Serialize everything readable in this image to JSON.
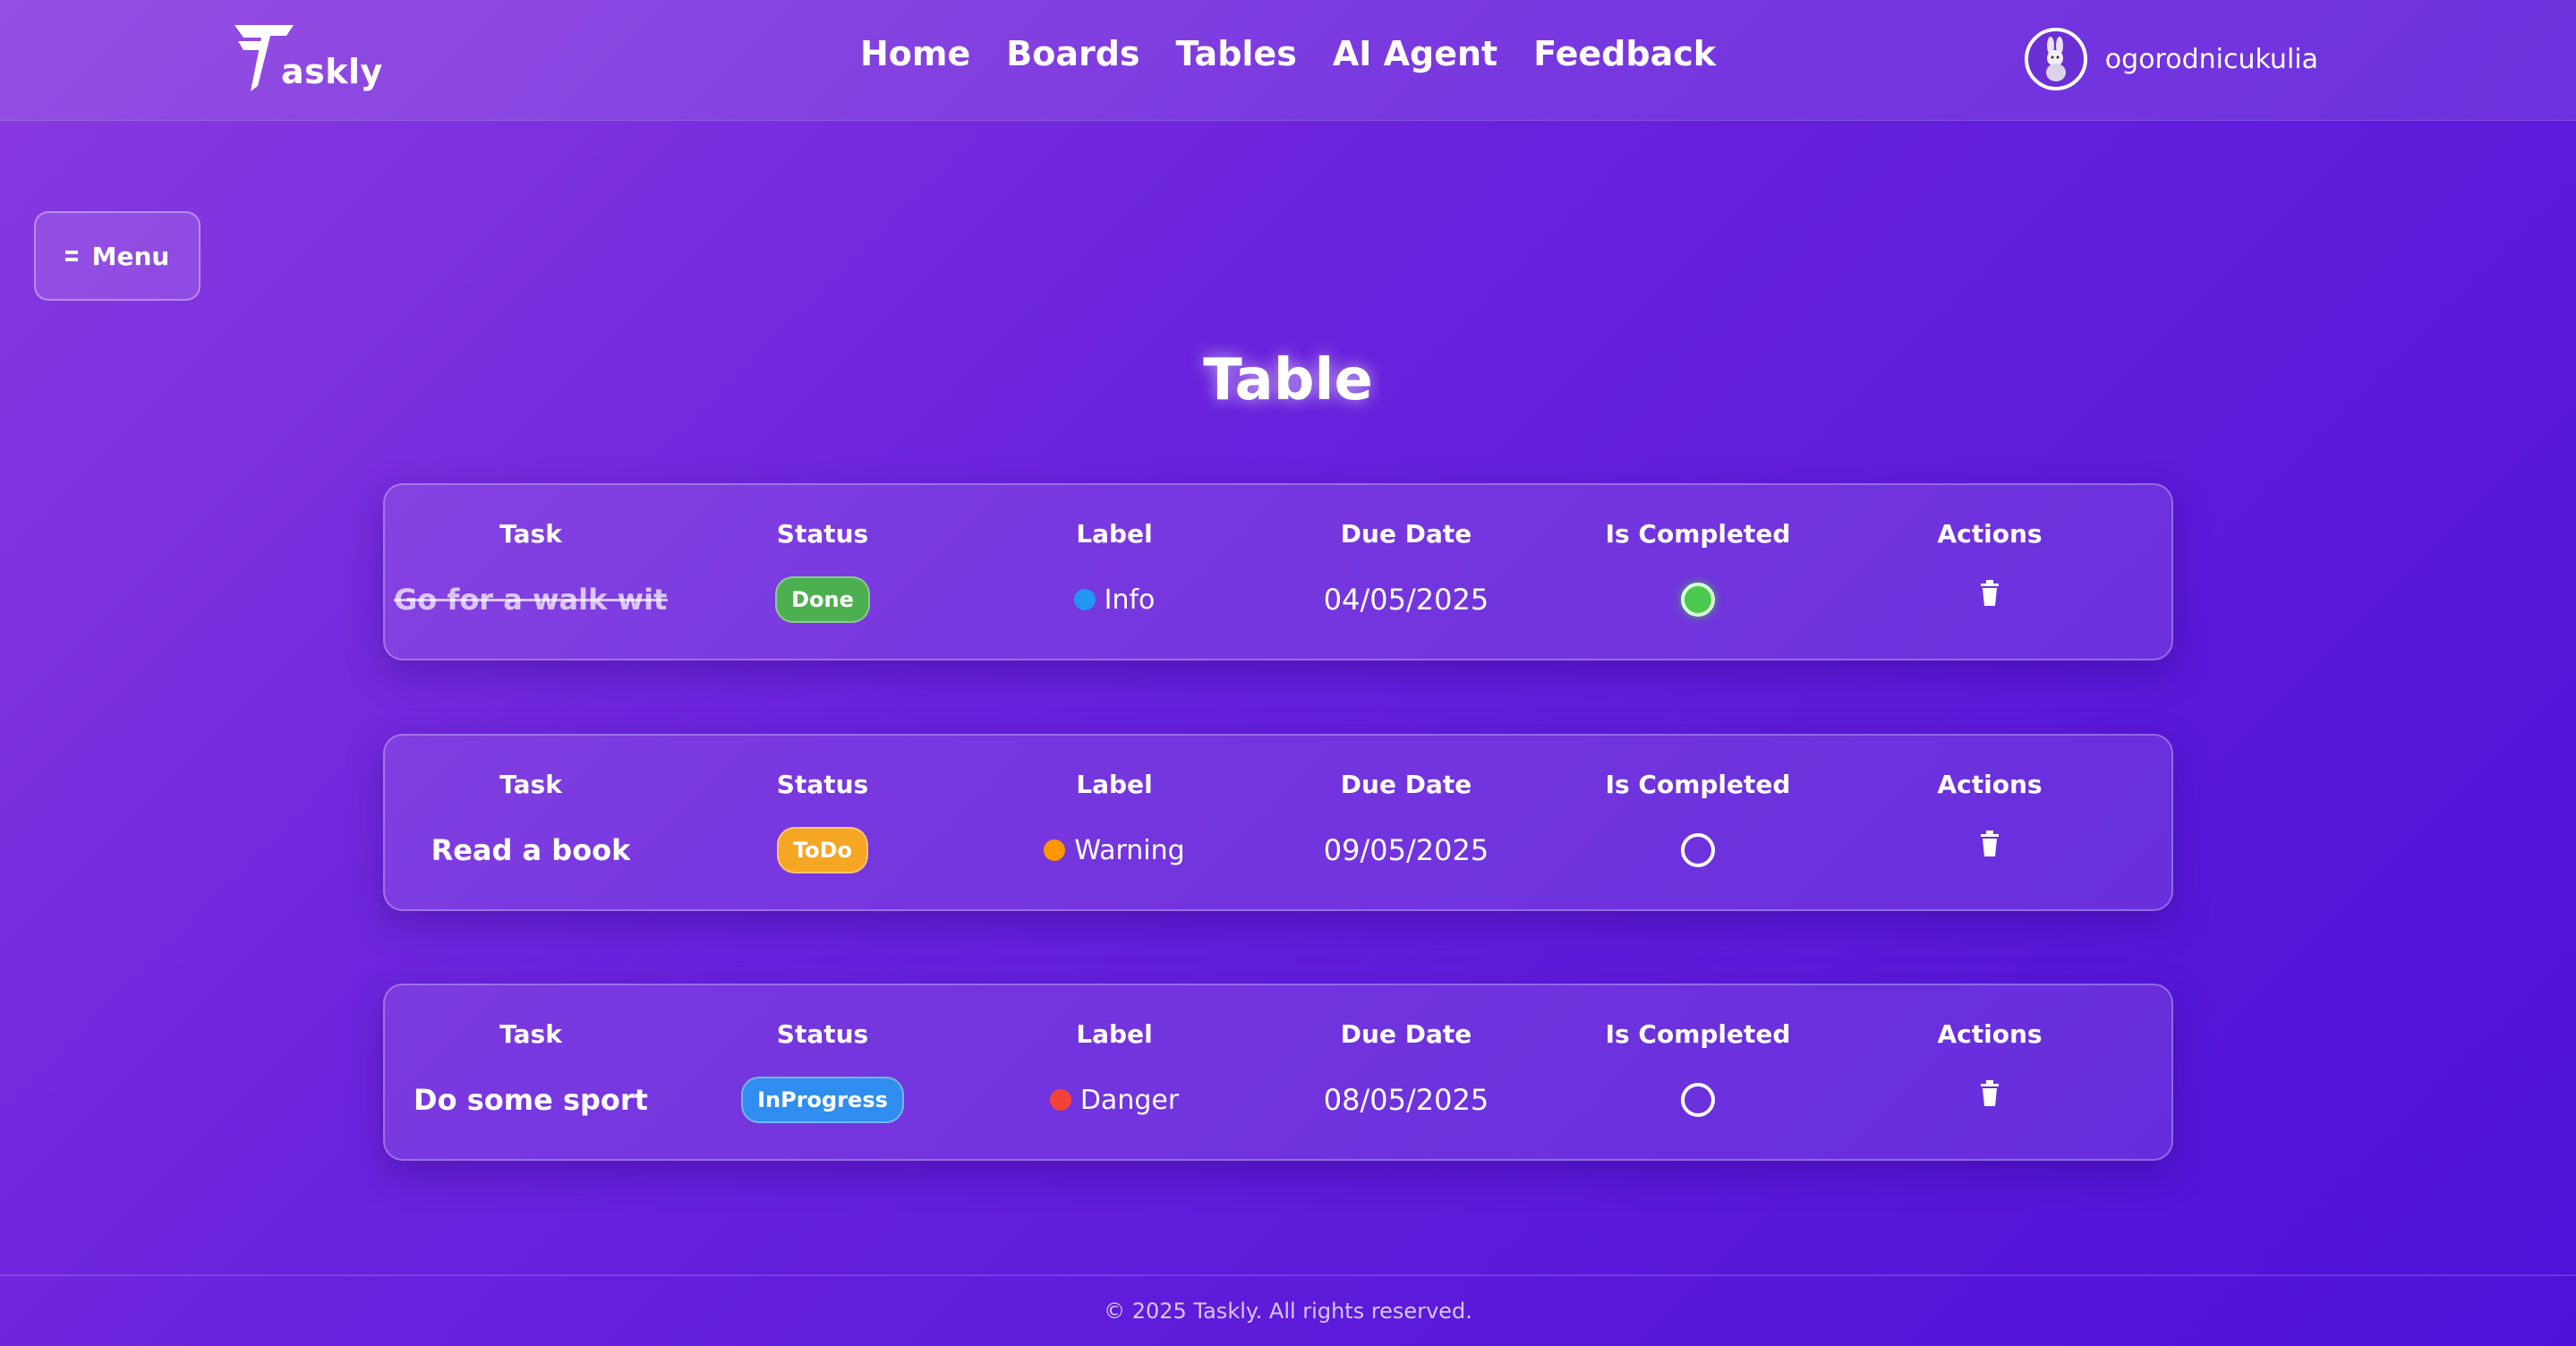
{
  "brand": {
    "logo_letter": "T",
    "name": "askly"
  },
  "nav": {
    "links": [
      "Home",
      "Boards",
      "Tables",
      "AI Agent",
      "Feedback"
    ]
  },
  "user": {
    "username": "ogorodnicukulia"
  },
  "menu": {
    "label": "Menu"
  },
  "page": {
    "title": "Table"
  },
  "table": {
    "headers": [
      "Task",
      "Status",
      "Label",
      "Due Date",
      "Is Completed",
      "Actions"
    ],
    "rows": [
      {
        "task": "Go for a walk with d",
        "status": "Done",
        "status_color": "#4caf50",
        "label": "Info",
        "label_color": "#2196f3",
        "due_date": "04/05/2025",
        "completed": true
      },
      {
        "task": "Read a book",
        "status": "ToDo",
        "status_color": "#f5a623",
        "label": "Warning",
        "label_color": "#ff9800",
        "due_date": "09/05/2025",
        "completed": false
      },
      {
        "task": "Do some sport",
        "status": "InProgress",
        "status_color": "#2f8ef0",
        "label": "Danger",
        "label_color": "#f44336",
        "due_date": "08/05/2025",
        "completed": false
      }
    ]
  },
  "footer": {
    "text": "© 2025 Taskly. All rights reserved."
  }
}
